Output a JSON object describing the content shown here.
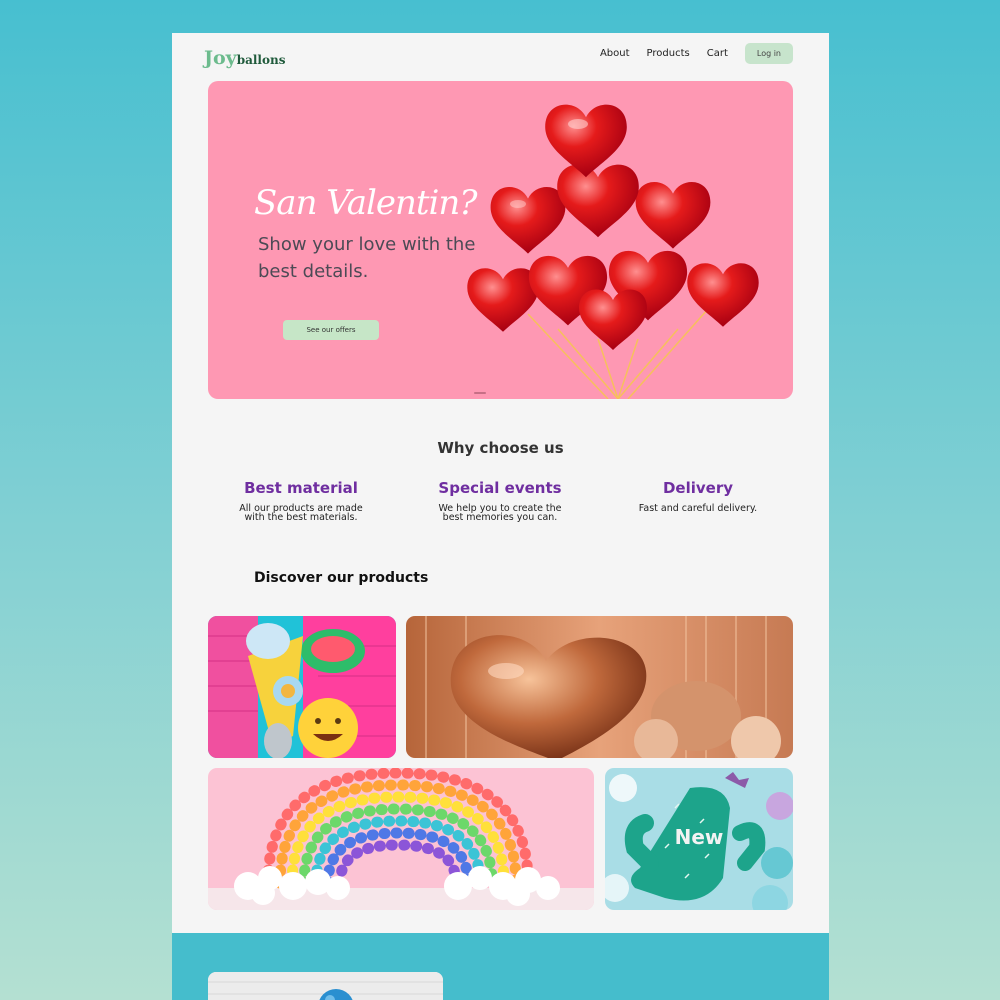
{
  "brand": {
    "joy": "Joy",
    "rest": "ballons"
  },
  "nav": {
    "about": "About",
    "products": "Products",
    "cart": "Cart",
    "login": "Log in"
  },
  "hero": {
    "script_title": "San Valentin?",
    "headline": "Show your love with the best details.",
    "cta": "See our offers"
  },
  "why": {
    "title": "Why choose us",
    "features": [
      {
        "title": "Best material",
        "desc": "All our products are made with the best materials."
      },
      {
        "title": "Special events",
        "desc": "We help you to create the best memories you can."
      },
      {
        "title": "Delivery",
        "desc": "Fast and careful delivery."
      }
    ]
  },
  "products": {
    "title": "Discover our products",
    "new_label": "New"
  },
  "colors": {
    "accent": "#6f2ea0",
    "hero_bg": "#fe98b3",
    "button_green": "#c6e6c7"
  }
}
